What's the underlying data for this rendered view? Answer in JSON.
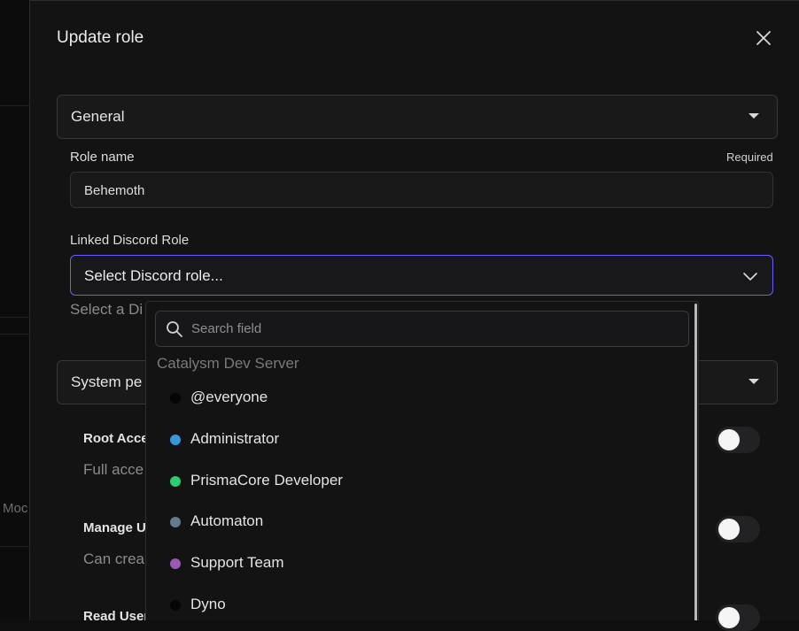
{
  "background": {
    "peek_text": "Moc"
  },
  "modal": {
    "title": "Update role",
    "close_icon": "close-icon",
    "general_section": {
      "label": "General"
    },
    "role_name": {
      "label": "Role name",
      "required": "Required",
      "value": "Behemoth"
    },
    "linked_role": {
      "label": "Linked Discord Role",
      "selected": "Select Discord role...",
      "helper": "Select a Di"
    },
    "system_section": {
      "label": "System pe"
    },
    "permissions": [
      {
        "title": "Root Acce",
        "desc": "Full acce",
        "enabled": false
      },
      {
        "title": "Manage U",
        "desc": "Can crea",
        "enabled": false
      },
      {
        "title": "Read User",
        "desc": "",
        "enabled": false
      }
    ]
  },
  "dropdown": {
    "search_placeholder": "Search field",
    "group_label": "Catalysm Dev Server",
    "options": [
      {
        "name": "@everyone",
        "color": "#050505"
      },
      {
        "name": "Administrator",
        "color": "#3498db"
      },
      {
        "name": "PrismaCore Developer",
        "color": "#2ecc71"
      },
      {
        "name": "Automaton",
        "color": "#607d8b"
      },
      {
        "name": "Support Team",
        "color": "#9b59b6"
      },
      {
        "name": "Dyno",
        "color": "#050505"
      }
    ]
  },
  "colors": {
    "accent_border": "#6a5cff",
    "panel_bg": "#131314"
  }
}
